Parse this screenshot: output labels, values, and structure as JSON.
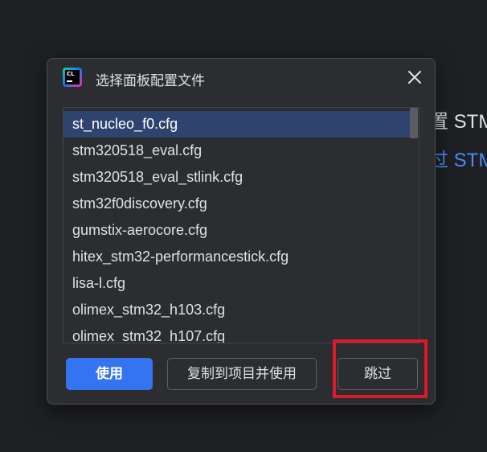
{
  "background": {
    "line1": "置 STM",
    "line2": "过 STM"
  },
  "dialog": {
    "title": "选择面板配置文件",
    "logo_text": "CL",
    "close_icon": "close-icon"
  },
  "list": {
    "selected_index": 0,
    "items": [
      "st_nucleo_f0.cfg",
      "stm320518_eval.cfg",
      "stm320518_eval_stlink.cfg",
      "stm32f0discovery.cfg",
      "gumstix-aerocore.cfg",
      "hitex_stm32-performancestick.cfg",
      "lisa-l.cfg",
      "olimex_stm32_h103.cfg",
      "olimex_stm32_h107.cfg"
    ]
  },
  "buttons": {
    "use": "使用",
    "copy_and_use": "复制到项目并使用",
    "skip": "跳过"
  },
  "colors": {
    "accent": "#3574f0",
    "selection": "#2e436e",
    "highlight_annotation": "#e0182d",
    "link": "#4a8cf0"
  }
}
